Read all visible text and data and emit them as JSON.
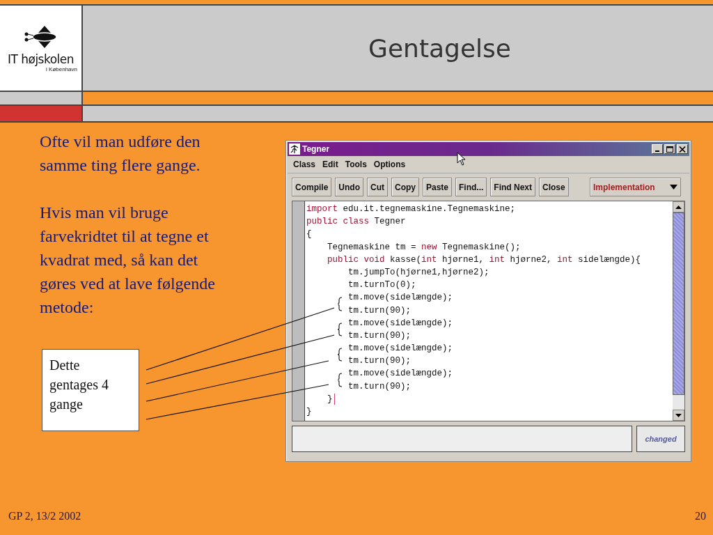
{
  "header": {
    "logo": {
      "name": "IT højskolen",
      "subtitle": "i København"
    },
    "title": "Gentagelse"
  },
  "body_text": [
    "Ofte vil man udføre den samme ting flere gange.",
    "Hvis man vil bruge farvekridtet til at tegne et kvadrat med, så kan det gøres ved at lave følgende metode:"
  ],
  "callout": {
    "text": "Dette gentages 4 gange"
  },
  "window": {
    "title": "Tegner",
    "menu": [
      "Class",
      "Edit",
      "Tools",
      "Options"
    ],
    "toolbar": [
      "Compile",
      "Undo",
      "Cut",
      "Copy",
      "Paste",
      "Find...",
      "Find Next",
      "Close"
    ],
    "view_selector": {
      "value": "Implementation"
    },
    "code": [
      {
        "kind": "line",
        "tokens": [
          {
            "text": "import",
            "kind": "keyword"
          },
          {
            "text": " edu.it.tegnemaskine.Tegnemaskine;",
            "kind": "plain"
          }
        ]
      },
      {
        "kind": "line",
        "tokens": [
          {
            "text": "public class",
            "kind": "keyword"
          },
          {
            "text": " Tegner",
            "kind": "plain"
          }
        ]
      },
      {
        "kind": "line",
        "tokens": [
          {
            "text": "{",
            "kind": "plain"
          }
        ],
        "children": [
          {
            "kind": "line",
            "tokens": [
              {
                "text": "Tegnemaskine tm = ",
                "kind": "plain"
              },
              {
                "text": "new",
                "kind": "keyword"
              },
              {
                "text": " Tegnemaskine();",
                "kind": "plain"
              }
            ]
          },
          {
            "kind": "line",
            "tokens": [
              {
                "text": "public void",
                "kind": "keyword"
              },
              {
                "text": " kasse(",
                "kind": "plain"
              },
              {
                "text": "int",
                "kind": "keyword"
              },
              {
                "text": " hjørne1, ",
                "kind": "plain"
              },
              {
                "text": "int",
                "kind": "keyword"
              },
              {
                "text": " hjørne2, ",
                "kind": "plain"
              },
              {
                "text": "int",
                "kind": "keyword"
              },
              {
                "text": " sidelængde){",
                "kind": "plain"
              }
            ],
            "children": [
              {
                "kind": "line",
                "tokens": [
                  {
                    "text": "tm.jumpTo(hjørne1,hjørne2);",
                    "kind": "plain"
                  }
                ]
              },
              {
                "kind": "line",
                "tokens": [
                  {
                    "text": "tm.turnTo(0);",
                    "kind": "plain"
                  }
                ]
              },
              {
                "kind": "brace_start",
                "tokens": [
                  {
                    "text": "tm.move(sidelængde);",
                    "kind": "plain"
                  }
                ]
              },
              {
                "kind": "brace_end",
                "tokens": [
                  {
                    "text": "tm.turn(90);",
                    "kind": "plain"
                  }
                ]
              },
              {
                "kind": "brace_start",
                "tokens": [
                  {
                    "text": "tm.move(sidelængde);",
                    "kind": "plain"
                  }
                ]
              },
              {
                "kind": "brace_end",
                "tokens": [
                  {
                    "text": "tm.turn(90);",
                    "kind": "plain"
                  }
                ]
              },
              {
                "kind": "brace_start",
                "tokens": [
                  {
                    "text": "tm.move(sidelængde);",
                    "kind": "plain"
                  }
                ]
              },
              {
                "kind": "brace_end",
                "tokens": [
                  {
                    "text": "tm.turn(90);",
                    "kind": "plain"
                  }
                ]
              },
              {
                "kind": "brace_start",
                "tokens": [
                  {
                    "text": "tm.move(sidelængde);",
                    "kind": "plain"
                  }
                ]
              },
              {
                "kind": "brace_end",
                "tokens": [
                  {
                    "text": "tm.turn(90);",
                    "kind": "plain"
                  }
                ]
              }
            ]
          },
          {
            "kind": "line",
            "caret": true,
            "tokens": [
              {
                "text": "}",
                "kind": "plain"
              }
            ]
          }
        ]
      },
      {
        "kind": "line",
        "tokens": [
          {
            "text": "}",
            "kind": "plain"
          }
        ]
      }
    ],
    "status": "changed"
  },
  "footer": {
    "left": "GP 2, 13/2 2002",
    "page": "20"
  }
}
